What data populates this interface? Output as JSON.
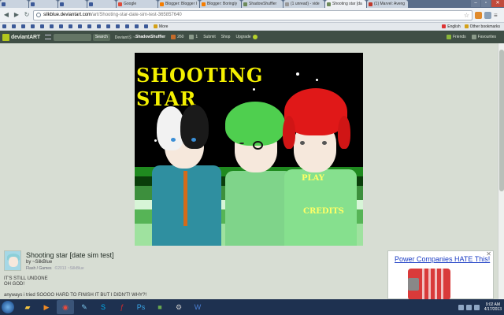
{
  "browser": {
    "tabs": [
      {
        "label": "",
        "favicon": "facebook"
      },
      {
        "label": "",
        "favicon": "facebook"
      },
      {
        "label": "",
        "favicon": "facebook"
      },
      {
        "label": "",
        "favicon": "facebook"
      },
      {
        "label": "Google",
        "favicon": "google"
      },
      {
        "label": "Blogger: Blogger I",
        "favicon": "blogger"
      },
      {
        "label": "Blogger: Boringly",
        "favicon": "blogger"
      },
      {
        "label": "ShadowShuffler",
        "favicon": "deviantart"
      },
      {
        "label": "(1 unread) - vide",
        "favicon": "email"
      },
      {
        "label": "Shooting star [da",
        "favicon": "deviantart",
        "active": true
      },
      {
        "label": "(1) Marvel: Aveng",
        "favicon": "marvel"
      }
    ],
    "url_host": "silkblue.deviantart.com",
    "url_path": "/art/Shooting-star-date-sim-test-365857640",
    "bookmarks": [
      {
        "label": "",
        "icon": "facebook"
      },
      {
        "label": "",
        "icon": "facebook"
      },
      {
        "label": "",
        "icon": "facebook"
      },
      {
        "label": "",
        "icon": "facebook"
      },
      {
        "label": "",
        "icon": "facebook"
      },
      {
        "label": "",
        "icon": "facebook"
      },
      {
        "label": "",
        "icon": "facebook"
      },
      {
        "label": "",
        "icon": "facebook"
      },
      {
        "label": "",
        "icon": "facebook"
      },
      {
        "label": "",
        "icon": "facebook"
      },
      {
        "label": "",
        "icon": "facebook"
      },
      {
        "label": "",
        "icon": "facebook"
      },
      {
        "label": "",
        "icon": "facebook"
      },
      {
        "label": "",
        "icon": "facebook"
      },
      {
        "label": "",
        "icon": "facebook"
      },
      {
        "label": "",
        "icon": "facebook"
      },
      {
        "label": "More",
        "icon": "folder"
      }
    ],
    "bookmarks_right": [
      {
        "label": "English",
        "icon": "flag"
      },
      {
        "label": "Other bookmarks",
        "icon": "folder"
      }
    ]
  },
  "da_header": {
    "logo": "deviantART",
    "search_button": "Search",
    "user_prefix": "DeviantⓈ ~",
    "username": "ShadowShuffler",
    "notifications": "260",
    "messages": "1",
    "submit": "Submit",
    "shop": "Shop",
    "upgrade": "Upgrade",
    "friends": "Friends",
    "favourites": "Favourites"
  },
  "artwork": {
    "title_line1": "SHOOTING",
    "title_line2": "STAR",
    "menu_play": "PLAY",
    "menu_credits": "CREDITS"
  },
  "deviation": {
    "title": "Shooting star [date sim test]",
    "by": "by ~SilkBlue",
    "category": "Flash / Games",
    "copyright": "©2013 ~SilkBlue"
  },
  "description": [
    "IT'S STILL UNDONE",
    "OH GOD!",
    "",
    "anyways i tried SOOOO HARD TO FINISH IT BUT I DIDN'T! WHY?!"
  ],
  "ad": {
    "headline": "Power Companies HATE This!"
  },
  "taskbar": {
    "time": "9:02 AM",
    "date": "4/17/2013"
  },
  "colors": {
    "da_header": "#3f4e45",
    "page_bg": "#d7ddd3",
    "title_yellow": "#f4f000",
    "ad_link": "#1a3cc4"
  }
}
